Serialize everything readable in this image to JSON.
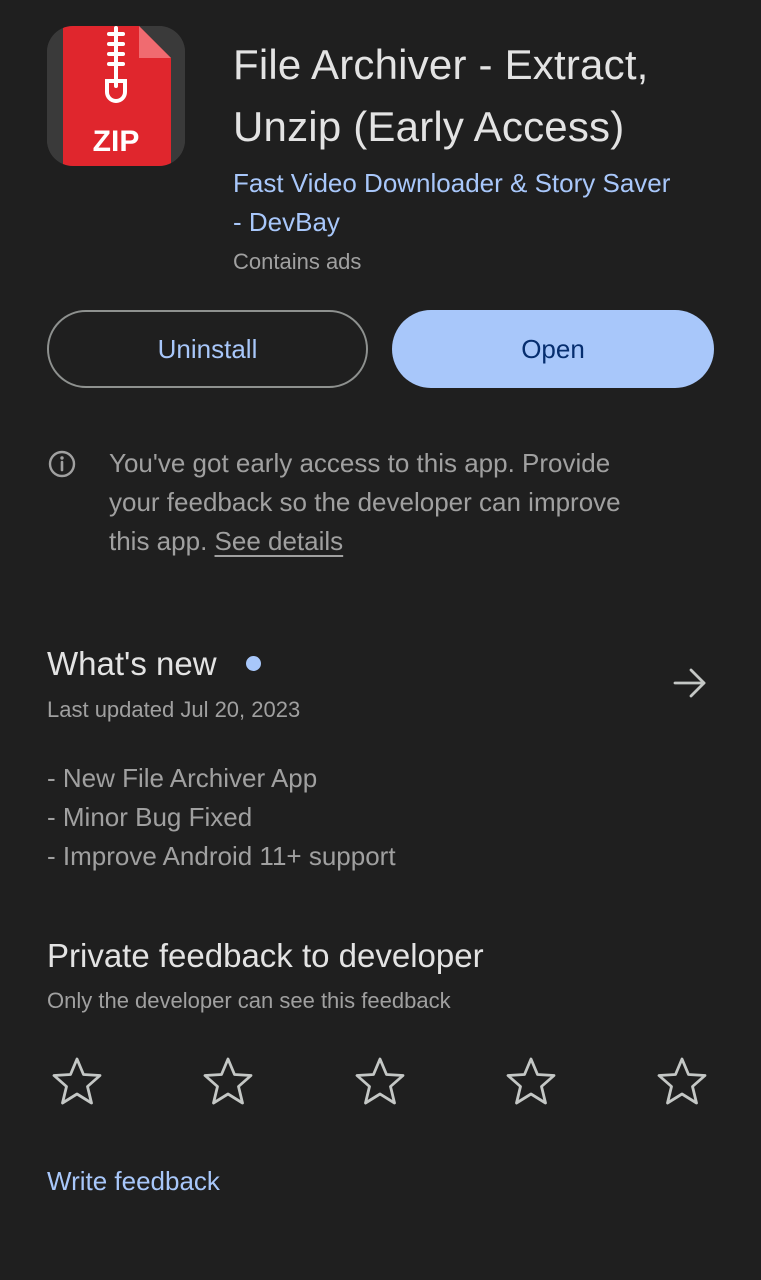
{
  "app": {
    "title_line1": "File Archiver - Extract,",
    "title_line2": "Unzip (Early Access)",
    "developer_line1": "Fast Video Downloader & Story Saver",
    "developer_line2": "- DevBay",
    "contains_ads": "Contains ads",
    "icon_text": "ZIP",
    "icon_name": "zip-file-icon",
    "icon_color": "#e0262d"
  },
  "actions": {
    "uninstall_label": "Uninstall",
    "open_label": "Open"
  },
  "early_access": {
    "icon": "info-icon",
    "line1": "You've got early access to this app. Provide",
    "line2": "your feedback so the developer can improve",
    "line3_prefix": "this app. ",
    "link_label": "See details"
  },
  "whats_new": {
    "title": "What's new",
    "last_updated": "Last updated Jul 20, 2023",
    "notes": [
      "- New File Archiver App",
      "- Minor Bug Fixed",
      "- Improve Android 11+ support"
    ],
    "arrow_icon": "arrow-right-icon"
  },
  "private_feedback": {
    "title": "Private feedback to developer",
    "subtitle": "Only the developer can see this feedback",
    "rating": 0,
    "max_rating": 5,
    "star_icon": "star-outline-icon",
    "write_feedback_label": "Write feedback"
  },
  "colors": {
    "background": "#1f1f1f",
    "accent": "#a8c7fa",
    "primary_text": "#e3e3e3",
    "secondary_text": "#a0a0a0"
  }
}
